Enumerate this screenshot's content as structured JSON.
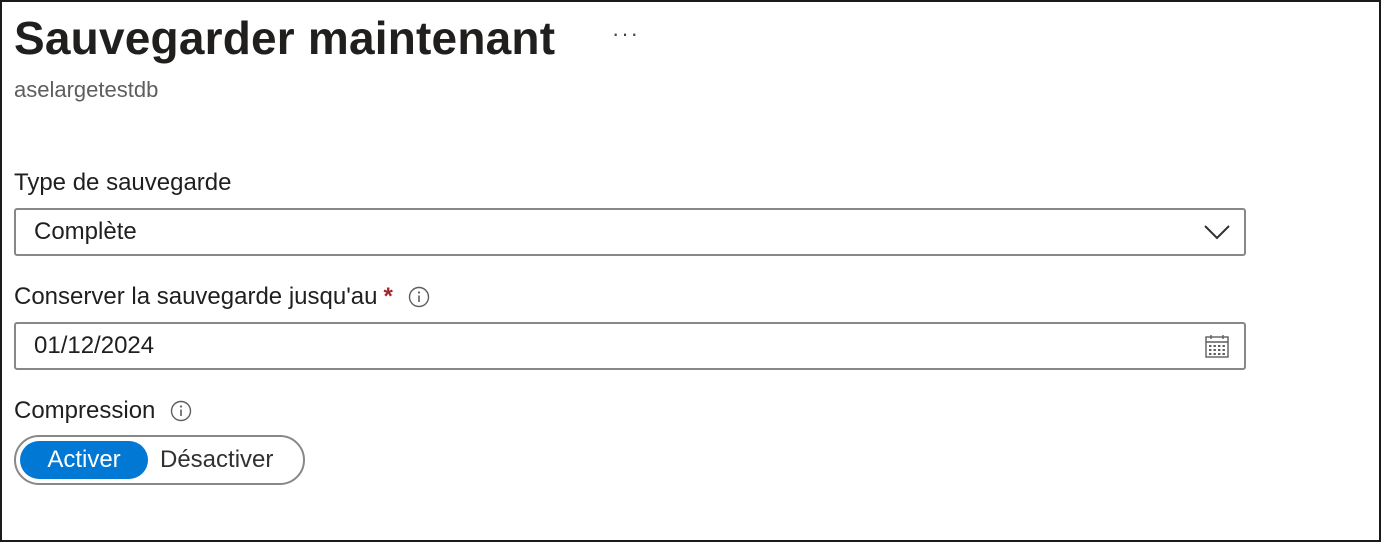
{
  "header": {
    "title": "Sauvegarder maintenant",
    "more_label": "···",
    "subtitle": "aselargetestdb"
  },
  "form": {
    "backup_type": {
      "label": "Type de sauvegarde",
      "value": "Complète",
      "icon": "chevron-down-icon"
    },
    "retain_until": {
      "label": "Conserver la sauvegarde jusqu'au",
      "required_mark": "*",
      "value": "01/12/2024",
      "icon": "calendar-icon"
    },
    "compression": {
      "label": "Compression",
      "options": [
        "Activer",
        "Désactiver"
      ],
      "selected": "Activer"
    }
  },
  "colors": {
    "accent": "#0078d4",
    "required": "#a4262c",
    "border": "#8a8886"
  }
}
